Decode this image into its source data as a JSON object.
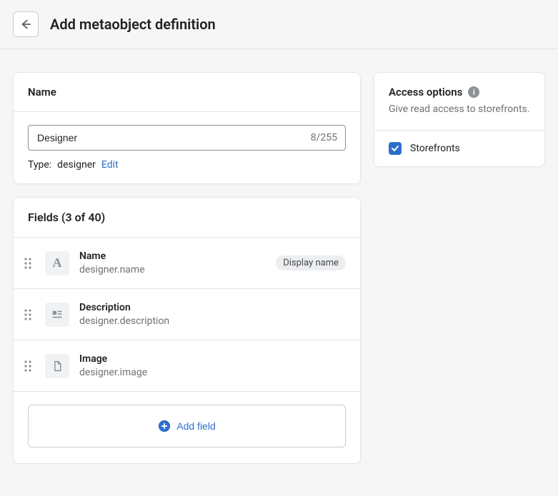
{
  "header": {
    "title": "Add metaobject definition"
  },
  "name_card": {
    "title": "Name",
    "input_value": "Designer",
    "char_count": "8/255",
    "type_label": "Type:",
    "type_value": "designer",
    "edit_label": "Edit"
  },
  "fields_card": {
    "title": "Fields (3 of 40)",
    "items": [
      {
        "name": "Name",
        "namespace": "designer",
        "key": "name",
        "badge": "Display name",
        "icon": "text"
      },
      {
        "name": "Description",
        "namespace": "designer",
        "key": "description",
        "badge": "",
        "icon": "richtext"
      },
      {
        "name": "Image",
        "namespace": "designer",
        "key": "image",
        "badge": "",
        "icon": "file"
      }
    ],
    "add_button": "Add field"
  },
  "access_card": {
    "title": "Access options",
    "description": "Give read access to storefronts.",
    "option_label": "Storefronts",
    "checked": true
  }
}
